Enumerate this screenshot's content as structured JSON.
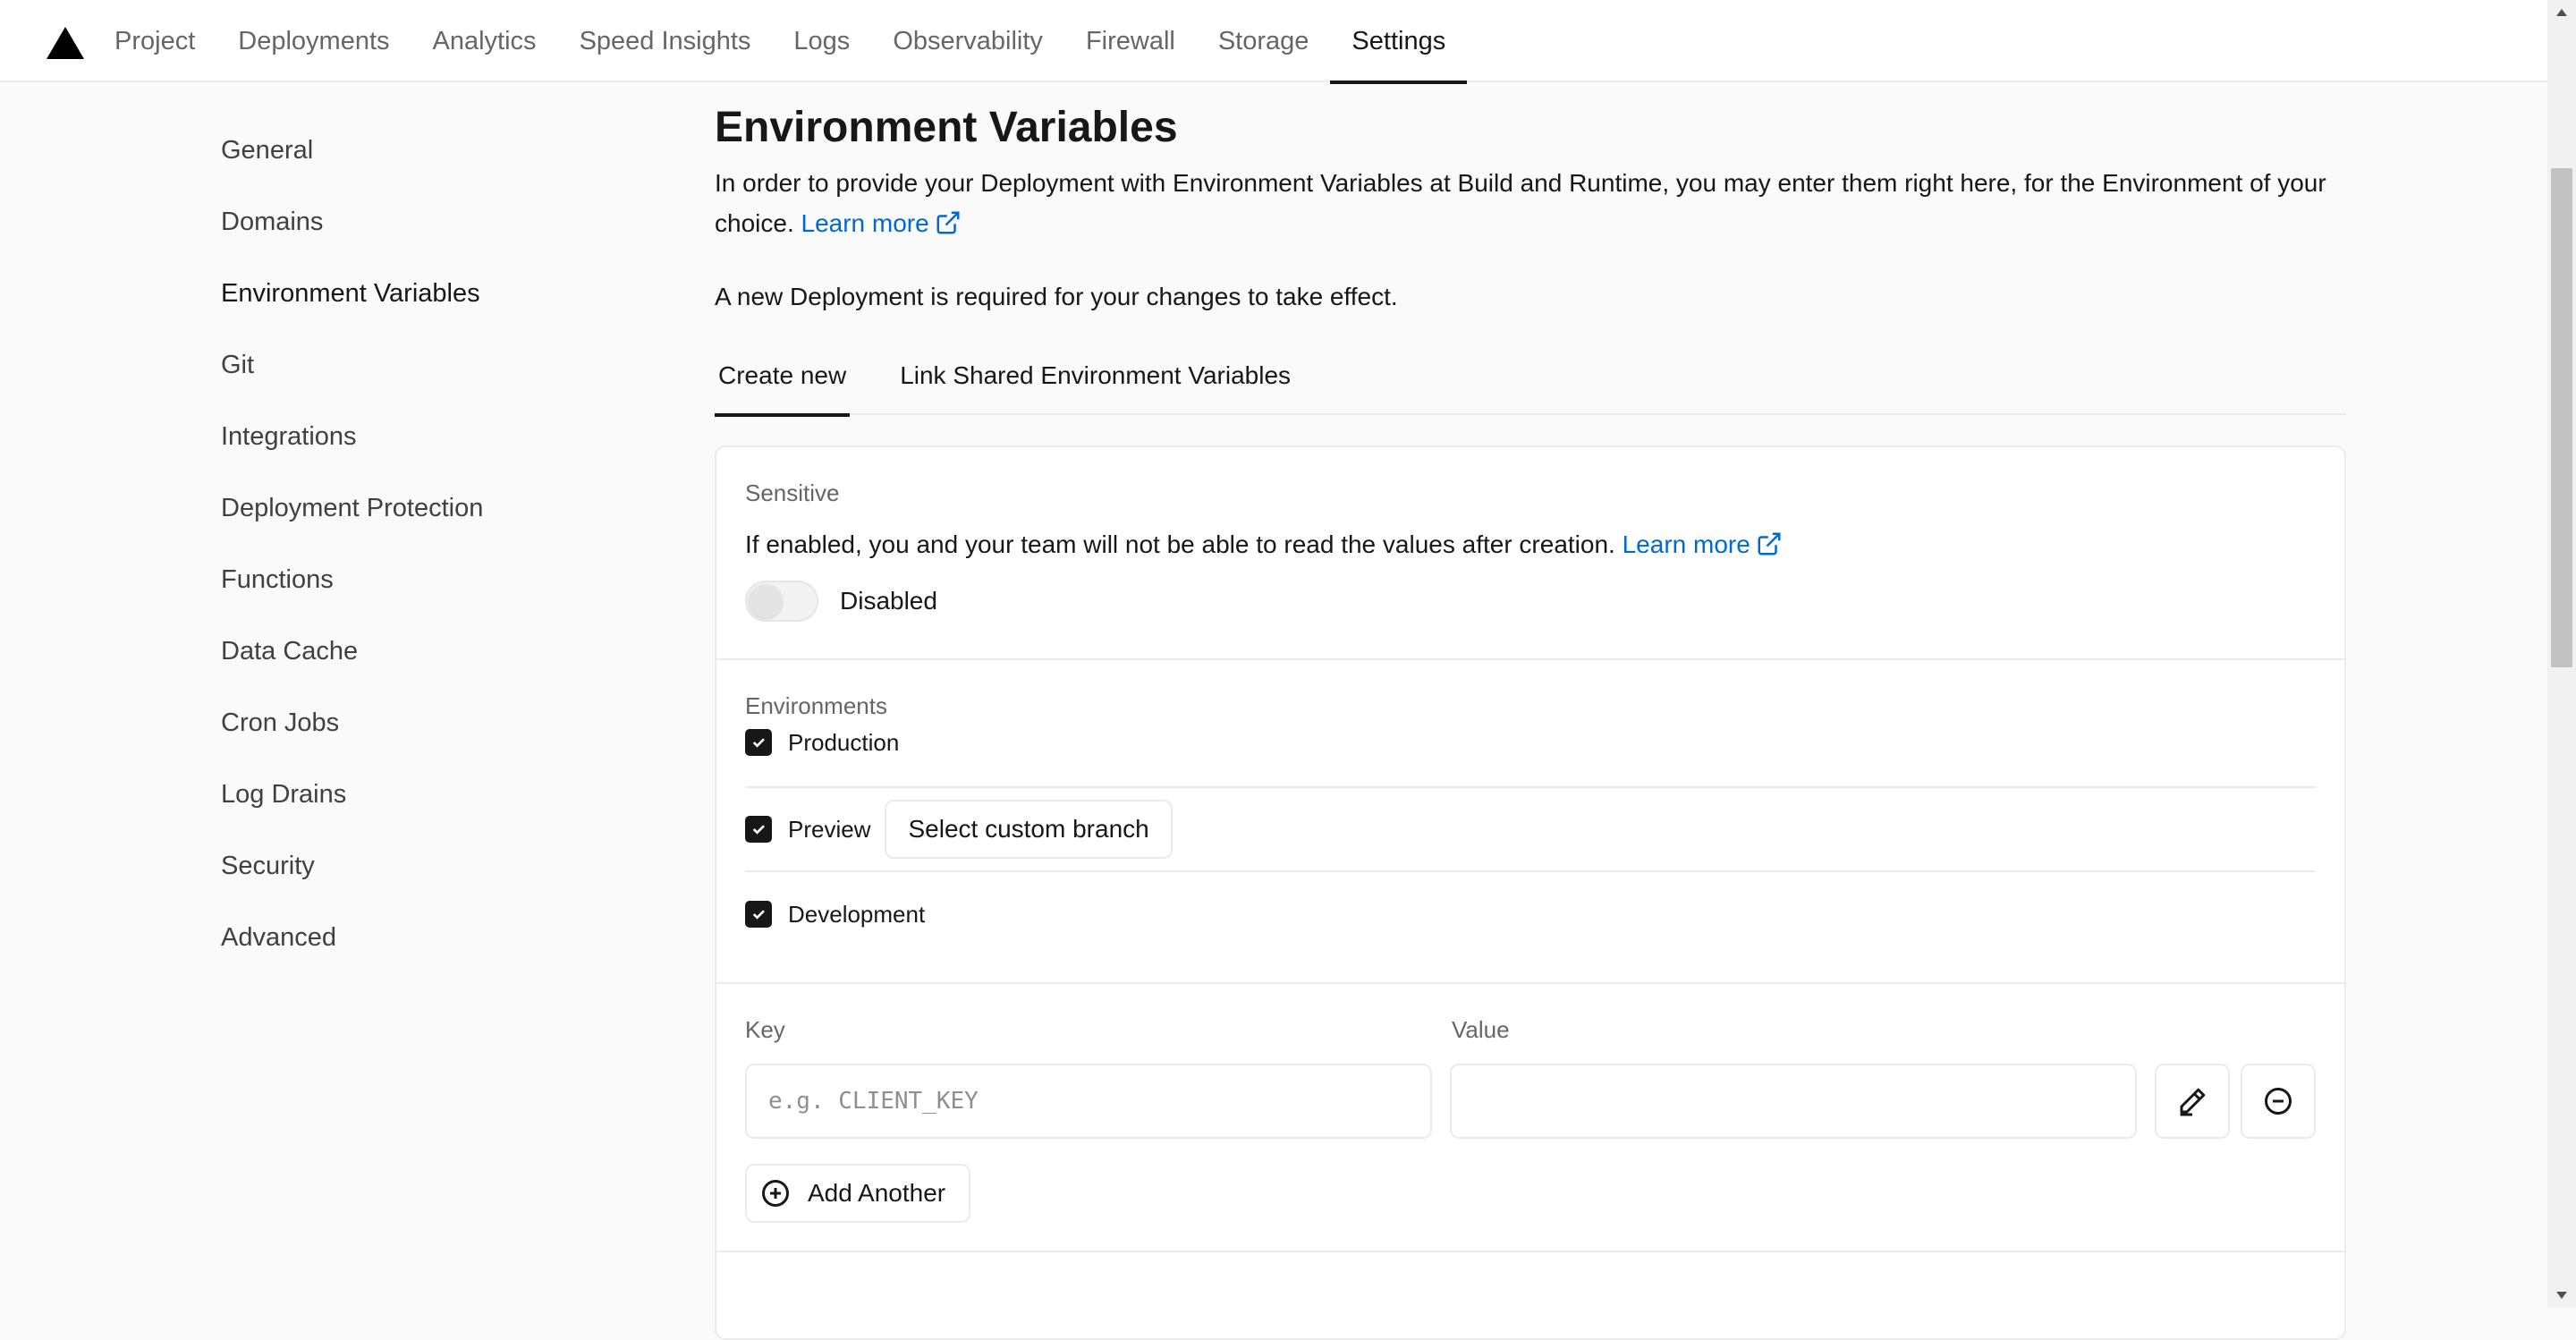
{
  "nav": {
    "items": [
      {
        "label": "Project"
      },
      {
        "label": "Deployments"
      },
      {
        "label": "Analytics"
      },
      {
        "label": "Speed Insights"
      },
      {
        "label": "Logs"
      },
      {
        "label": "Observability"
      },
      {
        "label": "Firewall"
      },
      {
        "label": "Storage"
      },
      {
        "label": "Settings",
        "active": true
      }
    ]
  },
  "sidebar": {
    "items": [
      {
        "label": "General"
      },
      {
        "label": "Domains"
      },
      {
        "label": "Environment Variables",
        "active": true
      },
      {
        "label": "Git"
      },
      {
        "label": "Integrations"
      },
      {
        "label": "Deployment Protection"
      },
      {
        "label": "Functions"
      },
      {
        "label": "Data Cache"
      },
      {
        "label": "Cron Jobs"
      },
      {
        "label": "Log Drains"
      },
      {
        "label": "Security"
      },
      {
        "label": "Advanced"
      }
    ]
  },
  "main": {
    "title": "Environment Variables",
    "description": "In order to provide your Deployment with Environment Variables at Build and Runtime, you may enter them right here, for the Environment of your choice.",
    "learn_more": "Learn more",
    "note": "A new Deployment is required for your changes to take effect.",
    "tabs": [
      {
        "label": "Create new",
        "active": true
      },
      {
        "label": "Link Shared Environment Variables"
      }
    ],
    "sensitive": {
      "label": "Sensitive",
      "text": "If enabled, you and your team will not be able to read the values after creation.",
      "learn_more": "Learn more",
      "toggle_state": "Disabled"
    },
    "environments": {
      "label": "Environments",
      "production": "Production",
      "preview": "Preview",
      "select_branch": "Select custom branch",
      "development": "Development"
    },
    "kv": {
      "key_label": "Key",
      "value_label": "Value",
      "key_placeholder": "e.g. CLIENT_KEY",
      "value_value": "",
      "add_another": "Add Another"
    }
  },
  "colors": {
    "link": "#0068d6",
    "text": "#171717",
    "muted": "#666666",
    "border": "#ebebeb",
    "background": "#fafafa"
  }
}
